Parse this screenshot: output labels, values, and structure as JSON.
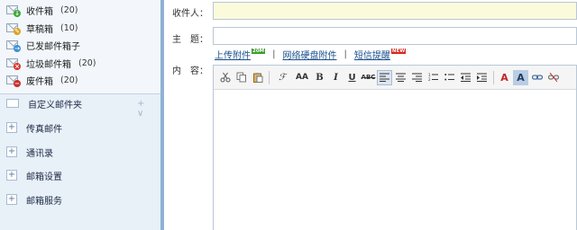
{
  "sidebar": {
    "folders": [
      {
        "name": "收件箱",
        "count": "(20)",
        "icon": "inbox-icon"
      },
      {
        "name": "草稿箱",
        "count": "(10)",
        "icon": "drafts-icon"
      },
      {
        "name": "已发邮件箱子",
        "count": "",
        "icon": "sent-icon"
      },
      {
        "name": "垃圾邮件箱",
        "count": "(20)",
        "icon": "spam-icon"
      },
      {
        "name": "废件箱",
        "count": "(20)",
        "icon": "trash-icon"
      }
    ],
    "custom_folder": {
      "label": "自定义邮件夹",
      "controls": "+ ∨"
    },
    "sections": [
      {
        "label": "传真邮件"
      },
      {
        "label": "通讯录"
      },
      {
        "label": "邮箱设置"
      },
      {
        "label": "邮箱服务"
      }
    ]
  },
  "compose": {
    "to_label": "收件人：",
    "subject_label": "主　题：",
    "content_label": "内　容：",
    "to_value": "",
    "subject_value": "",
    "attach_upload": "上传附件",
    "attach_upload_tag": "20M",
    "attach_disk": "网络硬盘附件",
    "sms_reminder": "短信提醒",
    "sms_tag": "NEW",
    "separator": "|"
  },
  "toolbar": {
    "font_family": "ℱ",
    "font_size": "AA",
    "bold": "B",
    "italic": "I",
    "underline": "U",
    "strike": "ABC",
    "font_color": "A",
    "bg_color": "A"
  },
  "colors": {
    "sidebar_bg": "#e8f0f8",
    "divider": "#8fb1d4",
    "to_field_bg": "#fbfbdc",
    "link": "#1b4f8d"
  }
}
